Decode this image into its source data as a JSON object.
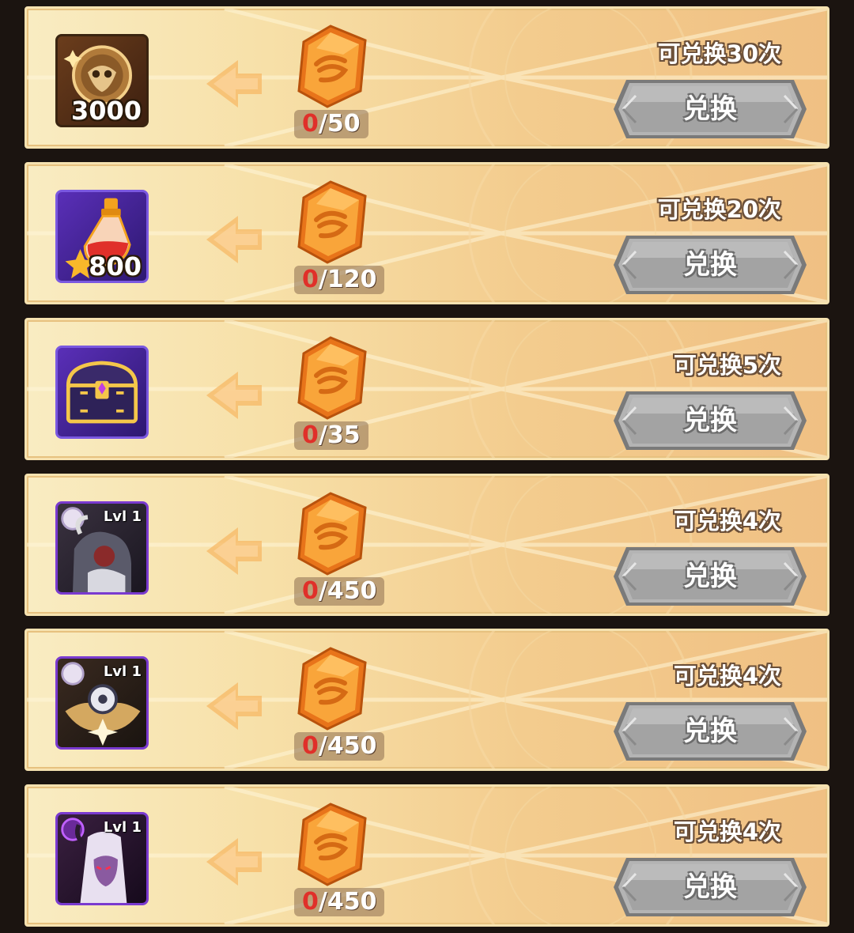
{
  "exchange_list": {
    "items": [
      {
        "icon": "gold-mask-coin-icon",
        "quantity": "3000",
        "level": "",
        "cost_have": "0",
        "cost_total": "/50",
        "limit": "可兑换30次",
        "button_label": "兑换"
      },
      {
        "icon": "red-potion-bottle-icon",
        "quantity": "800",
        "level": "",
        "cost_have": "0",
        "cost_total": "/120",
        "limit": "可兑换20次",
        "button_label": "兑换"
      },
      {
        "icon": "purple-treasure-chest-icon",
        "quantity": "",
        "level": "",
        "cost_have": "0",
        "cost_total": "/35",
        "limit": "可兑换5次",
        "button_label": "兑换"
      },
      {
        "icon": "hero-portrait-horned-icon",
        "quantity": "",
        "level": "Lvl 1",
        "cost_have": "0",
        "cost_total": "/450",
        "limit": "可兑换4次",
        "button_label": "兑换"
      },
      {
        "icon": "hero-portrait-winged-icon",
        "quantity": "",
        "level": "Lvl 1",
        "cost_have": "0",
        "cost_total": "/450",
        "limit": "可兑换4次",
        "button_label": "兑换"
      },
      {
        "icon": "hero-portrait-demon-icon",
        "quantity": "",
        "level": "Lvl 1",
        "cost_have": "0",
        "cost_total": "/450",
        "limit": "可兑换4次",
        "button_label": "兑换"
      }
    ],
    "currency_icon": "orange-crystal-token-icon",
    "colors": {
      "panel_light": "#f9ecc2",
      "panel_dark": "#f0c083",
      "currency": "#f79a2a",
      "cost_zero": "#e0302a",
      "button_gray": "#a8a8a8"
    }
  }
}
